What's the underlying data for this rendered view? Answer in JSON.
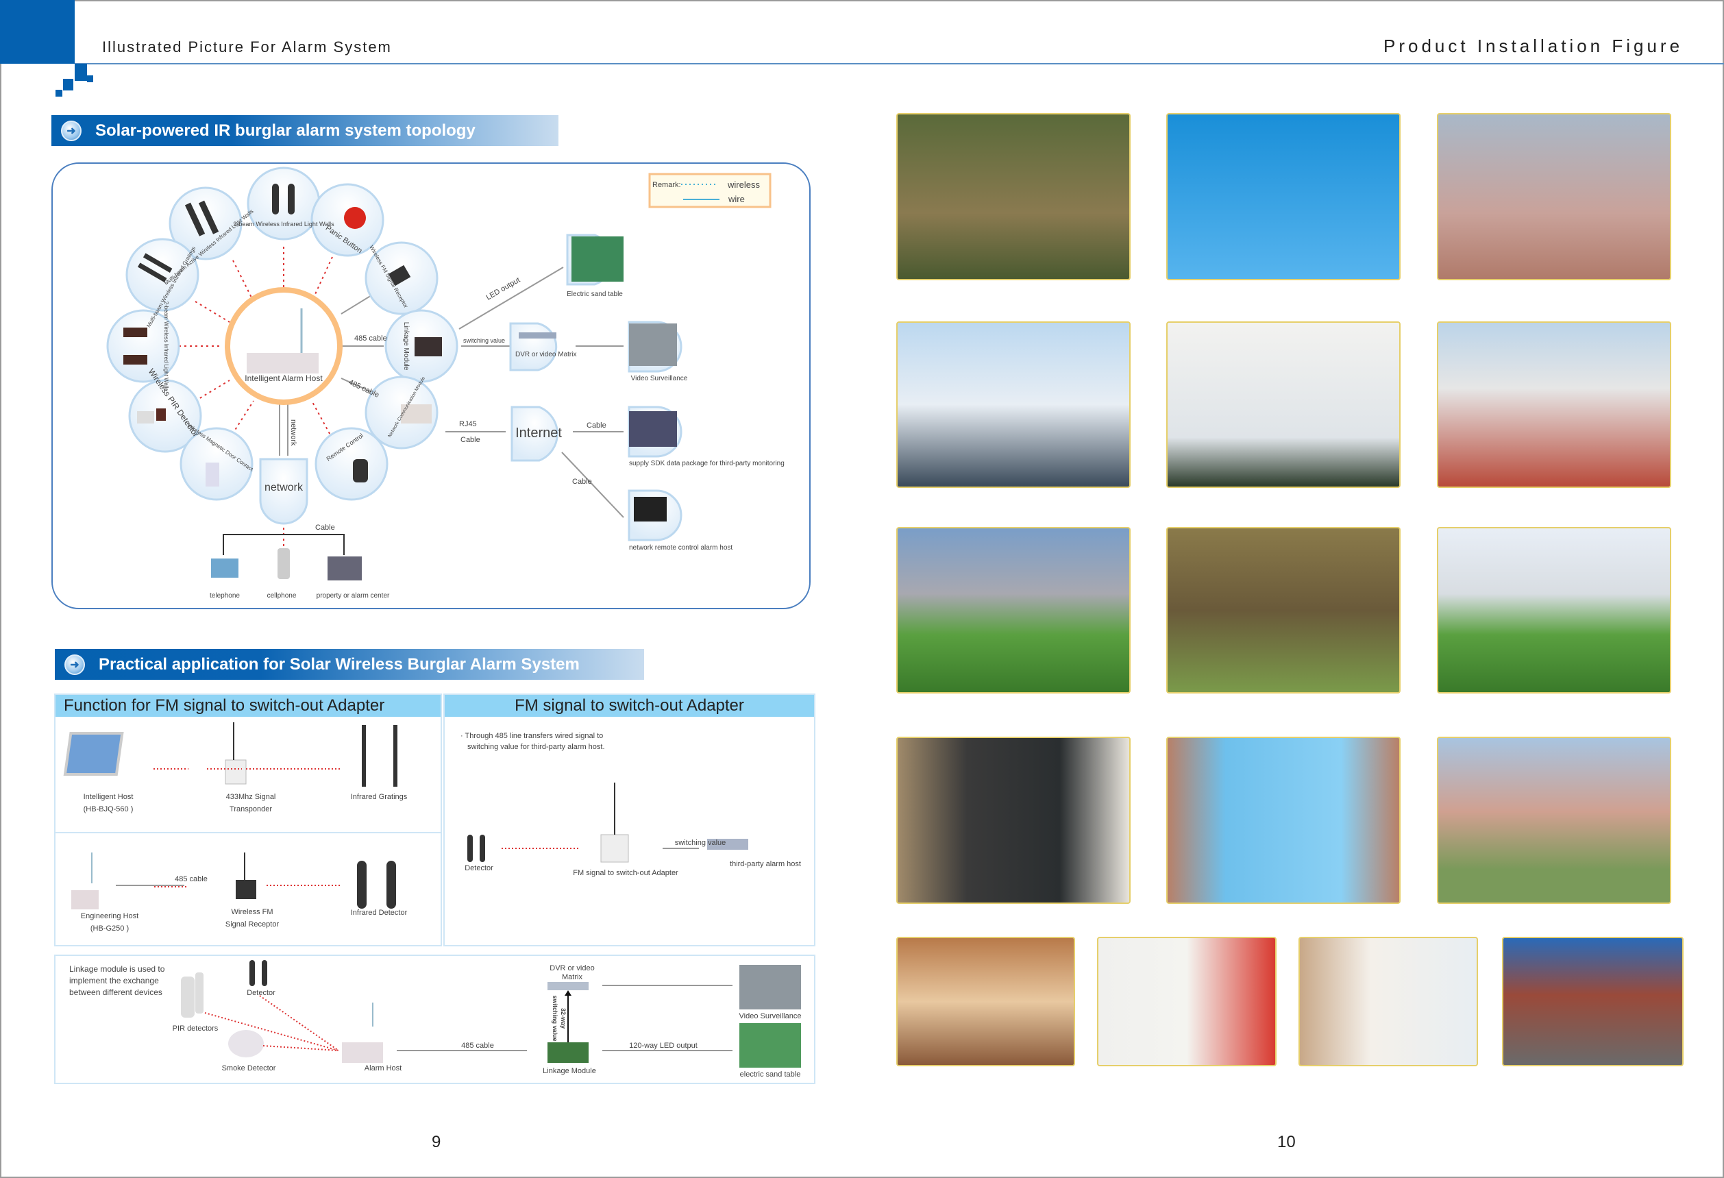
{
  "header": {
    "left_title": "Illustrated Picture For Alarm System",
    "right_title": "Product Installation Figure"
  },
  "section1": {
    "title": "Solar-powered IR burglar alarm system topology"
  },
  "remark": {
    "label": "Remark:",
    "wireless": "wireless",
    "wire": "wire"
  },
  "topology": {
    "center": "Intelligent Alarm Host",
    "nodes": {
      "three_beam": "3-beam Wireless Infrared Light Walls",
      "multi_active": "Multi-beam Active Wireless Infrared Light Walls",
      "panic": "Panic Button",
      "gratings": "Multi-beam Wireless Infrared Gratings",
      "fm_receptor": "Wireless FM Signal Receptor",
      "two_beam": "2-beam Wireless Infrared Light Walls",
      "linkage": "Linkage Module",
      "pir": "Wireless PIR Detector",
      "net_comm": "Network Communication Module",
      "door": "Wireless Magnetic Door Contact",
      "remote": "Remote Control",
      "network": "network",
      "internet": "Internet",
      "dvr": "DVR or video Matrix",
      "sand": "Electric sand table",
      "video": "Video Surveillance",
      "sdk": "supply SDK data package for third-party monitoring",
      "remote_host": "network remote control alarm host",
      "telephone": "telephone",
      "cellphone": "cellphone",
      "property": "property or alarm center"
    },
    "links": {
      "cable485a": "485 cable",
      "cable485b": "485 cable",
      "led": "LED output",
      "switching": "switching value",
      "rj45": "RJ45",
      "cable": "Cable",
      "cable2": "Cable",
      "cable3": "Cable",
      "network_line": "network",
      "cable4": "Cable"
    }
  },
  "section2": {
    "title": "Practical application for Solar Wireless Burglar Alarm System"
  },
  "left_panel": {
    "title": "Function for FM signal to switch-out Adapter",
    "row1": {
      "host": "Intelligent Host",
      "host_model": "(HB-BJQ-560 )",
      "transponder": "433Mhz Signal",
      "transponder2": "Transponder",
      "gratings": "Infrared Gratings"
    },
    "row2": {
      "host": "Engineering Host",
      "host_model": "(HB-G250 )",
      "cable": "485 cable",
      "receptor": "Wireless FM",
      "receptor2": "Signal Receptor",
      "detector": "Infrared Detector"
    }
  },
  "right_panel": {
    "title": "FM signal to switch-out Adapter",
    "note1": "· Through 485 line transfers wired signal to",
    "note2": "switching value for third-party alarm host.",
    "detector": "Detector",
    "adapter": "FM signal to switch-out Adapter",
    "switching": "switching value",
    "third": "third-party alarm host"
  },
  "bottom_panel": {
    "desc1": "Linkage module is used to",
    "desc2": "implement the exchange",
    "desc3": "between different devices",
    "detector": "Detector",
    "pir": "PIR detectors",
    "smoke": "Smoke Detector",
    "alarm_host": "Alarm Host",
    "cable": "485 cable",
    "dvr1": "DVR or video",
    "dvr2": "Matrix",
    "switch1": "32-way",
    "switch2": "switching value",
    "linkage": "Linkage Module",
    "led": "120-way LED output",
    "video": "Video Surveillance",
    "sand": "electric sand table"
  },
  "pages": {
    "left": "9",
    "right": "10"
  },
  "colors": {
    "brand_blue": "#0561b0",
    "panel_head": "#8fd4f5",
    "host_ring": "#fbbf7f",
    "photo_border": "#e6cf6a"
  }
}
